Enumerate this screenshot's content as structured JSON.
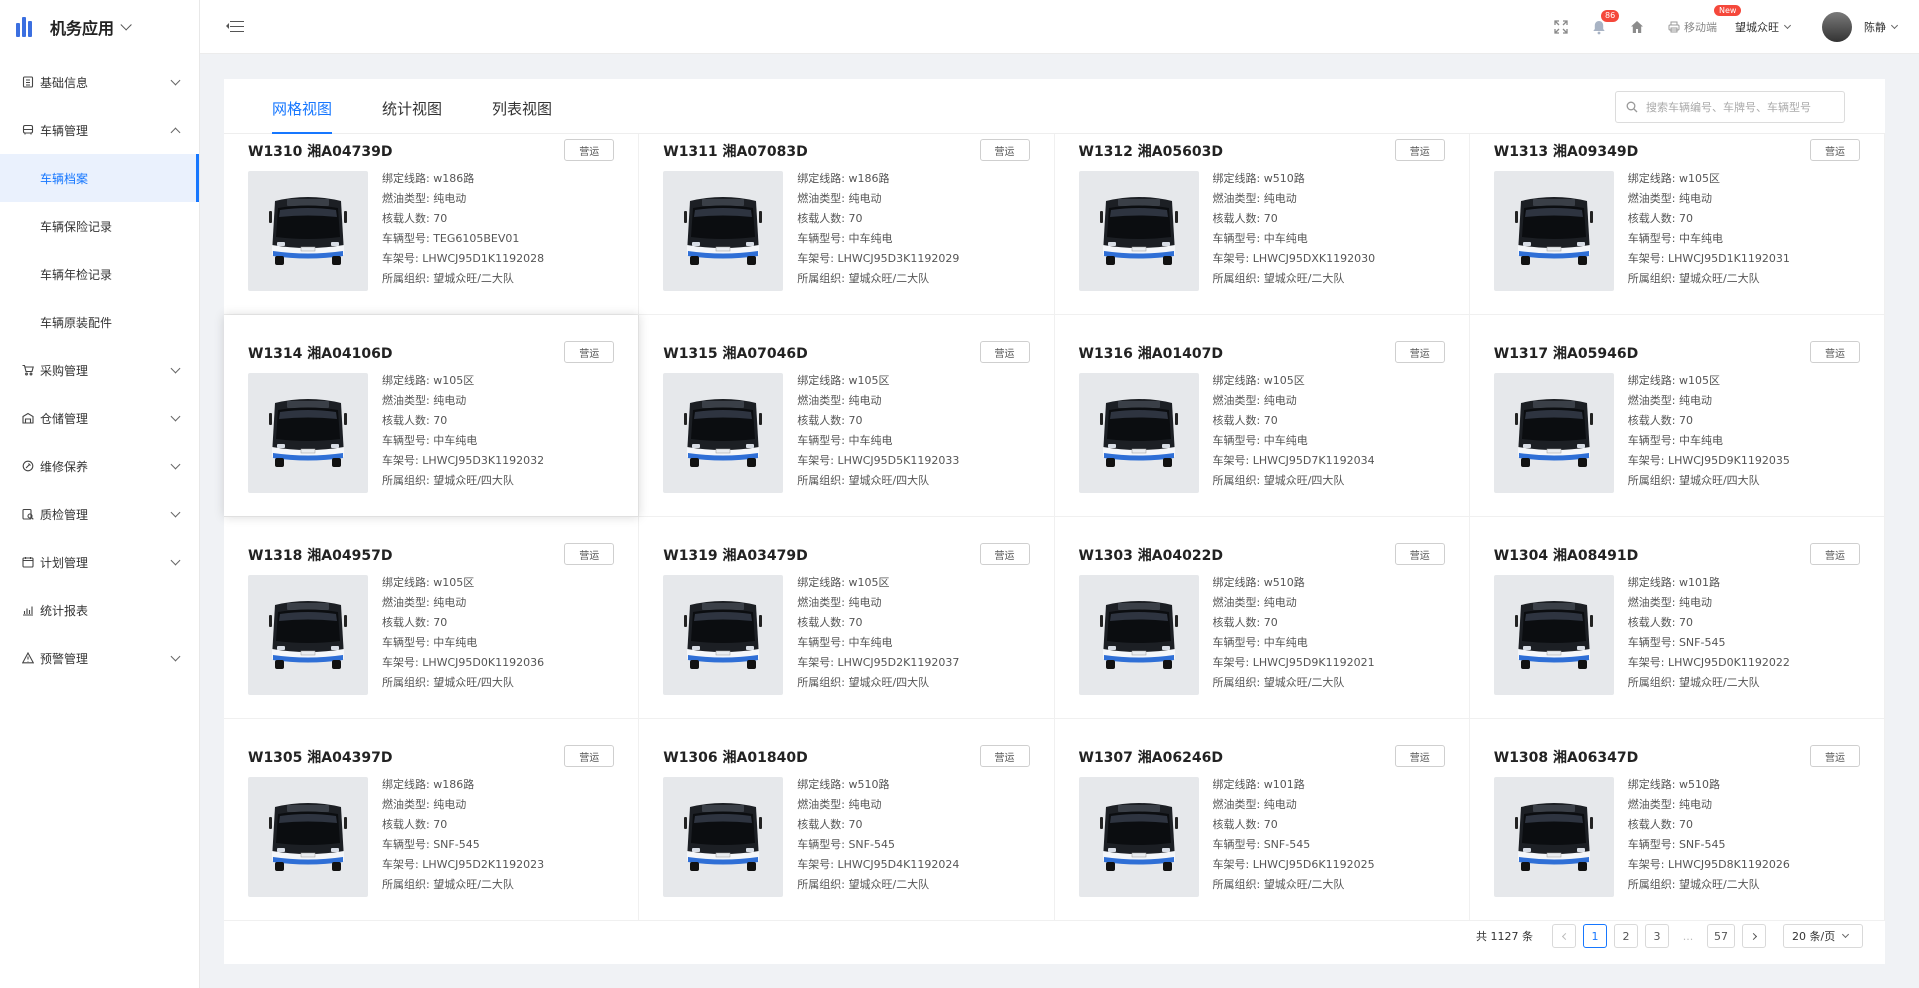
{
  "app": {
    "title": "机务应用"
  },
  "sidebar": {
    "items": [
      {
        "label": "基础信息",
        "icon": "building-icon",
        "expanded": false
      },
      {
        "label": "车辆管理",
        "icon": "bus-icon",
        "expanded": true,
        "children": [
          {
            "label": "车辆档案",
            "active": true
          },
          {
            "label": "车辆保险记录",
            "active": false
          },
          {
            "label": "车辆年检记录",
            "active": false
          },
          {
            "label": "车辆原装配件",
            "active": false
          }
        ]
      },
      {
        "label": "采购管理",
        "icon": "cart-icon",
        "expanded": false
      },
      {
        "label": "仓储管理",
        "icon": "warehouse-icon",
        "expanded": false
      },
      {
        "label": "维修保养",
        "icon": "wrench-icon",
        "expanded": false
      },
      {
        "label": "质检管理",
        "icon": "inspect-icon",
        "expanded": false
      },
      {
        "label": "计划管理",
        "icon": "calendar-icon",
        "expanded": false
      },
      {
        "label": "统计报表",
        "icon": "chart-icon",
        "expanded": null
      },
      {
        "label": "预警管理",
        "icon": "warning-icon",
        "expanded": false
      }
    ]
  },
  "header": {
    "notification_count": "86",
    "mobile_label": "移动端",
    "new_badge": "New",
    "org": "望城众旺",
    "user": "陈静"
  },
  "tabs": [
    "网格视图",
    "统计视图",
    "列表视图"
  ],
  "search": {
    "placeholder": "搜索车辆编号、车牌号、车辆型号"
  },
  "field_labels": {
    "route": "绑定线路: ",
    "fuel": "燃油类型: ",
    "capacity": "核载人数: ",
    "model": "车辆型号: ",
    "vin": "车架号: ",
    "org": "所属组织: "
  },
  "vehicles": [
    {
      "title": "W1310 湘A04739D",
      "status": "营运",
      "route": "w186路",
      "fuel": "纯电动",
      "capacity": "70",
      "model": "TEG6105BEV01",
      "vin": "LHWCJ95D1K1192028",
      "org": "望城众旺/二大队"
    },
    {
      "title": "W1311 湘A07083D",
      "status": "营运",
      "route": "w186路",
      "fuel": "纯电动",
      "capacity": "70",
      "model": "中车纯电",
      "vin": "LHWCJ95D3K1192029",
      "org": "望城众旺/二大队"
    },
    {
      "title": "W1312 湘A05603D",
      "status": "营运",
      "route": "w510路",
      "fuel": "纯电动",
      "capacity": "70",
      "model": "中车纯电",
      "vin": "LHWCJ95DXK1192030",
      "org": "望城众旺/二大队"
    },
    {
      "title": "W1313 湘A09349D",
      "status": "营运",
      "route": "w105区",
      "fuel": "纯电动",
      "capacity": "70",
      "model": "中车纯电",
      "vin": "LHWCJ95D1K1192031",
      "org": "望城众旺/二大队"
    },
    {
      "title": "W1314 湘A04106D",
      "status": "营运",
      "route": "w105区",
      "fuel": "纯电动",
      "capacity": "70",
      "model": "中车纯电",
      "vin": "LHWCJ95D3K1192032",
      "org": "望城众旺/四大队"
    },
    {
      "title": "W1315 湘A07046D",
      "status": "营运",
      "route": "w105区",
      "fuel": "纯电动",
      "capacity": "70",
      "model": "中车纯电",
      "vin": "LHWCJ95D5K1192033",
      "org": "望城众旺/四大队"
    },
    {
      "title": "W1316 湘A01407D",
      "status": "营运",
      "route": "w105区",
      "fuel": "纯电动",
      "capacity": "70",
      "model": "中车纯电",
      "vin": "LHWCJ95D7K1192034",
      "org": "望城众旺/四大队"
    },
    {
      "title": "W1317 湘A05946D",
      "status": "营运",
      "route": "w105区",
      "fuel": "纯电动",
      "capacity": "70",
      "model": "中车纯电",
      "vin": "LHWCJ95D9K1192035",
      "org": "望城众旺/四大队"
    },
    {
      "title": "W1318 湘A04957D",
      "status": "营运",
      "route": "w105区",
      "fuel": "纯电动",
      "capacity": "70",
      "model": "中车纯电",
      "vin": "LHWCJ95D0K1192036",
      "org": "望城众旺/四大队"
    },
    {
      "title": "W1319 湘A03479D",
      "status": "营运",
      "route": "w105区",
      "fuel": "纯电动",
      "capacity": "70",
      "model": "中车纯电",
      "vin": "LHWCJ95D2K1192037",
      "org": "望城众旺/四大队"
    },
    {
      "title": "W1303 湘A04022D",
      "status": "营运",
      "route": "w510路",
      "fuel": "纯电动",
      "capacity": "70",
      "model": "中车纯电",
      "vin": "LHWCJ95D9K1192021",
      "org": "望城众旺/二大队"
    },
    {
      "title": "W1304 湘A08491D",
      "status": "营运",
      "route": "w101路",
      "fuel": "纯电动",
      "capacity": "70",
      "model": "SNF-545",
      "vin": "LHWCJ95D0K1192022",
      "org": "望城众旺/二大队"
    },
    {
      "title": "W1305 湘A04397D",
      "status": "营运",
      "route": "w186路",
      "fuel": "纯电动",
      "capacity": "70",
      "model": "SNF-545",
      "vin": "LHWCJ95D2K1192023",
      "org": "望城众旺/二大队"
    },
    {
      "title": "W1306 湘A01840D",
      "status": "营运",
      "route": "w510路",
      "fuel": "纯电动",
      "capacity": "70",
      "model": "SNF-545",
      "vin": "LHWCJ95D4K1192024",
      "org": "望城众旺/二大队"
    },
    {
      "title": "W1307 湘A06246D",
      "status": "营运",
      "route": "w101路",
      "fuel": "纯电动",
      "capacity": "70",
      "model": "SNF-545",
      "vin": "LHWCJ95D6K1192025",
      "org": "望城众旺/二大队"
    },
    {
      "title": "W1308 湘A06347D",
      "status": "营运",
      "route": "w510路",
      "fuel": "纯电动",
      "capacity": "70",
      "model": "SNF-545",
      "vin": "LHWCJ95D8K1192026",
      "org": "望城众旺/二大队"
    }
  ],
  "pagination": {
    "total": "共 1127 条",
    "pages": [
      "1",
      "2",
      "3",
      "...",
      "57"
    ],
    "current": "1",
    "page_size": "20 条/页"
  },
  "colors": {
    "accent": "#1677ff",
    "badge": "#f5483b",
    "logo": "#3b6fe0"
  }
}
